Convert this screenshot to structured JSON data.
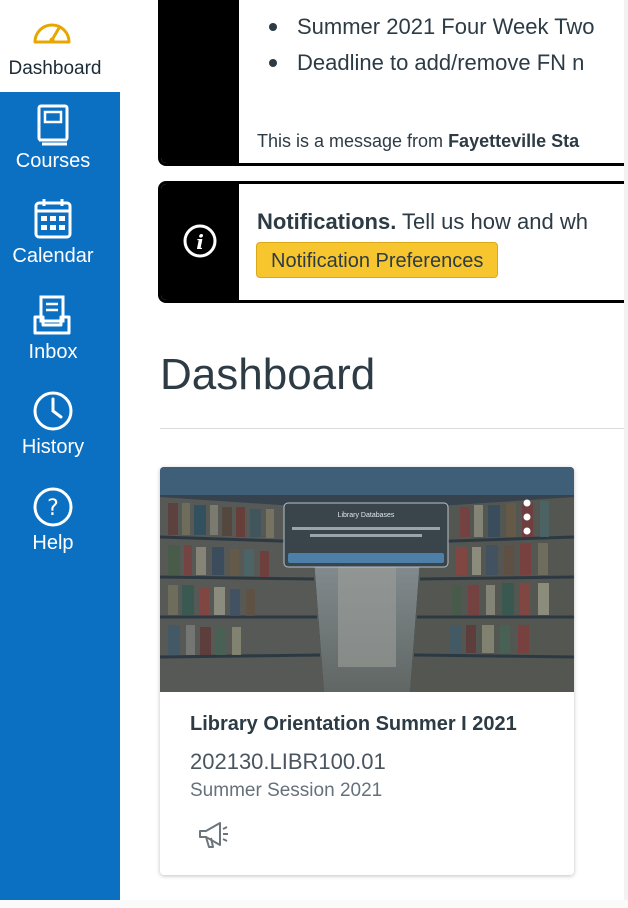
{
  "sidebar": {
    "items": [
      {
        "label": "Dashboard",
        "icon": "dashboard-gauge-icon",
        "active": true
      },
      {
        "label": "Courses",
        "icon": "book-icon"
      },
      {
        "label": "Calendar",
        "icon": "calendar-icon"
      },
      {
        "label": "Inbox",
        "icon": "inbox-icon"
      },
      {
        "label": "History",
        "icon": "clock-icon"
      },
      {
        "label": "Help",
        "icon": "question-circle-icon"
      }
    ],
    "bg_color": "#0b6fc2"
  },
  "announcement": {
    "items": [
      "Deadline to add/remove FN :",
      "Summer 2021 Four Week Two",
      "Deadline to add/remove FN n"
    ],
    "message_prefix": "This is a message from ",
    "message_source": "Fayetteville Sta"
  },
  "notification": {
    "heading": "Notifications.",
    "text": " Tell us how and wh",
    "button_label": "Notification Preferences",
    "button_color": "#f7c62f"
  },
  "page": {
    "title": "Dashboard"
  },
  "course_card": {
    "title": "Library Orientation Summer I 2021",
    "code": "202130.LIBR100.01",
    "term": "Summer Session 2021",
    "image_popup_title": "Library Databases"
  }
}
